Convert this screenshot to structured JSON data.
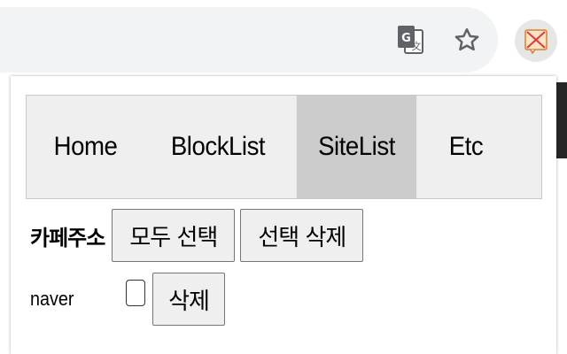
{
  "toolbar": {
    "icons": [
      "google-translate-icon",
      "bookmark-star-icon",
      "extension-icon"
    ]
  },
  "tabs": [
    {
      "label": "Home",
      "active": false
    },
    {
      "label": "BlockList",
      "active": false
    },
    {
      "label": "SiteList",
      "active": true
    },
    {
      "label": "Etc",
      "active": false
    }
  ],
  "sitelist": {
    "cafe_label": "카페주소",
    "select_all_label": "모두 선택",
    "delete_selected_label": "선택 삭제",
    "rows": [
      {
        "site": "naver",
        "checked": false,
        "delete_label": "삭제"
      }
    ]
  },
  "colors": {
    "active_tab": "#cccccc",
    "tab_bar": "#efefef",
    "omnibox": "#f1f3f4"
  }
}
